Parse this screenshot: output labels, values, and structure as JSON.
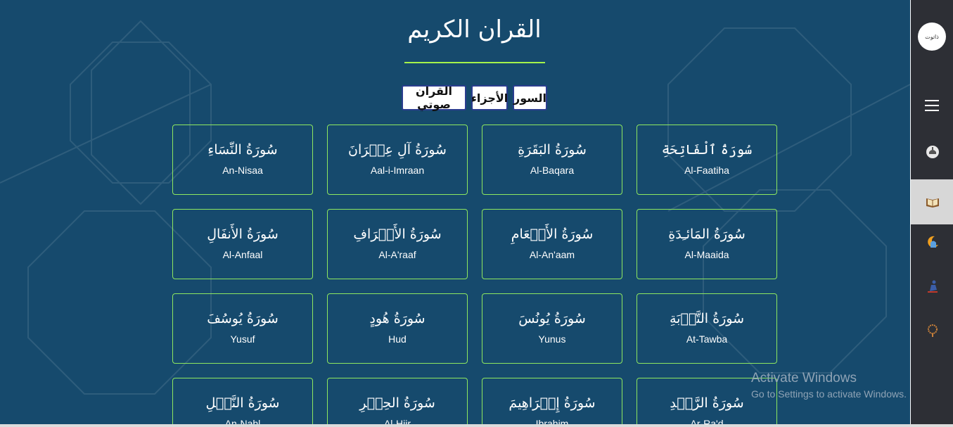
{
  "header": {
    "title": "القران الكريم"
  },
  "tabs": [
    {
      "label": "القران صوتي"
    },
    {
      "label": "الأجزاء"
    },
    {
      "label": "السور"
    }
  ],
  "surahs": [
    {
      "arabic": "سُورَةُ ٱلْفَاتِحَةِ",
      "english": "Al-Faatiha"
    },
    {
      "arabic": "سُورَةُ البَقَرَةِ",
      "english": "Al-Baqara"
    },
    {
      "arabic": "سُورَةُ آلِ عِمۡرَانَ",
      "english": "Aal-i-Imraan"
    },
    {
      "arabic": "سُورَةُ النِّسَاءِ",
      "english": "An-Nisaa"
    },
    {
      "arabic": "سُورَةُ المَائـِدَةِ",
      "english": "Al-Maaida"
    },
    {
      "arabic": "سُورَةُ الأَنۡعَامِ",
      "english": "Al-An'aam"
    },
    {
      "arabic": "سُورَةُ الأَعۡرَافِ",
      "english": "Al-A'raaf"
    },
    {
      "arabic": "سُورَةُ الأَنفَالِ",
      "english": "Al-Anfaal"
    },
    {
      "arabic": "سُورَةُ التَّوۡبَةِ",
      "english": "At-Tawba"
    },
    {
      "arabic": "سُورَةُ يُونُسَ",
      "english": "Yunus"
    },
    {
      "arabic": "سُورَةُ هُودٍ",
      "english": "Hud"
    },
    {
      "arabic": "سُورَةُ يُوسُفَ",
      "english": "Yusuf"
    },
    {
      "arabic": "سُورَةُ الرَّعۡدِ",
      "english": "Ar-Ra'd"
    },
    {
      "arabic": "سُورَةُ إِبۡرَاهِيمَ",
      "english": "Ibrahim"
    },
    {
      "arabic": "سُورَةُ الحِجۡرِ",
      "english": "Al-Hijr"
    },
    {
      "arabic": "سُورَةُ النَّحۡلِ",
      "english": "An-Nahl"
    }
  ],
  "sidebar": {
    "logo_text": "ذاتوت",
    "items": [
      {
        "icon": "mosque-badge-icon"
      },
      {
        "icon": "quran-book-icon",
        "active": true
      },
      {
        "icon": "crescent-mosque-icon"
      },
      {
        "icon": "praying-person-icon"
      },
      {
        "icon": "prayer-beads-icon"
      }
    ]
  },
  "watermark": {
    "line1": "Activate Windows",
    "line2": "Go to Settings to activate Windows."
  },
  "colors": {
    "background": "#164a6d",
    "accent_green": "#8ee860",
    "sidebar": "#2d2f35"
  }
}
